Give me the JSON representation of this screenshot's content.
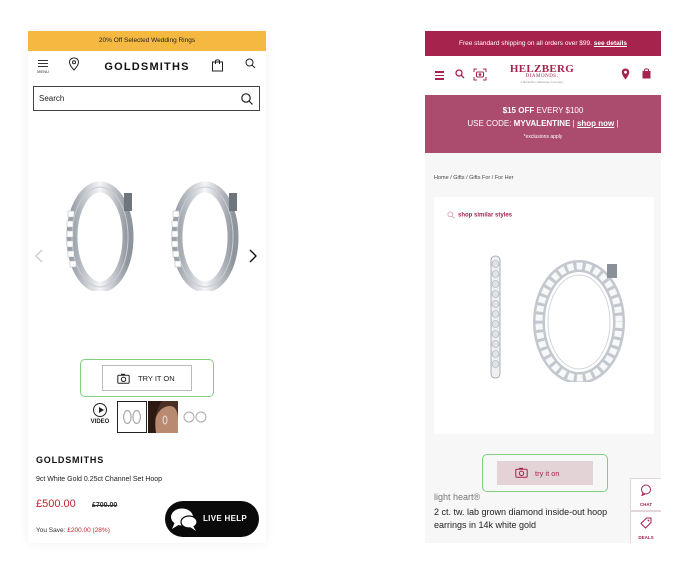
{
  "left": {
    "promo_text": "20% Off Selected Wedding Rings",
    "menu_label": "MENU",
    "logo_text": "GOLDSMITHS",
    "search_placeholder": "Search",
    "try_on_label": "TRY IT ON",
    "video_label": "VIDEO",
    "brand": "GOLDSMITHS",
    "product_name": "9ct White Gold 0.25ct Channel Set Hoop",
    "price": "£500.00",
    "was_price": "£700.00",
    "you_save_label": "You Save:",
    "you_save_amount": "£200.00 (28%)",
    "live_help_label": "LIVE HELP",
    "accent_color": "#f5b942",
    "price_color": "#c0262d"
  },
  "right": {
    "shipping_text": "Free standard shipping on all orders over $99.",
    "shipping_link": "see details",
    "logo_line1": "HELZBERG",
    "logo_line2": "DIAMONDS.",
    "logo_line3": "A Berkshire Hathaway Company",
    "promo_line1_bold": "$15 OFF",
    "promo_line1_rest": "EVERY $100",
    "promo_code_prefix": "USE CODE:",
    "promo_code": "MYVALENTINE",
    "promo_separator": "|",
    "promo_shop_link": "shop now",
    "promo_note": "*exclusions apply",
    "breadcrumb": "Home  /  Gifts  /  Gifts For  /  For Her",
    "shop_similar": "shop similar styles",
    "try_on_label": "try it on",
    "brand": "light heart®",
    "product_title": "2 ct. tw. lab grown diamond inside-out hoop earrings in 14k white gold",
    "chat_label": "CHAT",
    "deals_label": "DEALS",
    "brand_color": "#a6234d"
  }
}
